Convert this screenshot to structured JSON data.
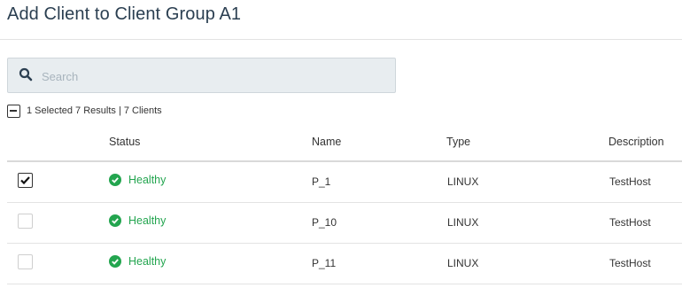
{
  "page": {
    "title": "Add Client to Client Group A1"
  },
  "search": {
    "placeholder": "Search",
    "value": ""
  },
  "summary": {
    "text": "1 Selected 7 Results | 7 Clients"
  },
  "table": {
    "columns": [
      "Status",
      "Name",
      "Type",
      "Description"
    ],
    "rows": [
      {
        "selected": true,
        "status": "Healthy",
        "name": "P_1",
        "type": "LINUX",
        "description": "TestHost"
      },
      {
        "selected": false,
        "status": "Healthy",
        "name": "P_10",
        "type": "LINUX",
        "description": "TestHost"
      },
      {
        "selected": false,
        "status": "Healthy",
        "name": "P_11",
        "type": "LINUX",
        "description": "TestHost"
      }
    ]
  },
  "colors": {
    "healthy": "#23a54f",
    "title": "#2b3f51",
    "search_bg": "#e8edf0"
  },
  "icons": {
    "search": "search-icon",
    "status_ok": "check-circle-icon",
    "checkbox_checked": "checkmark-icon"
  }
}
